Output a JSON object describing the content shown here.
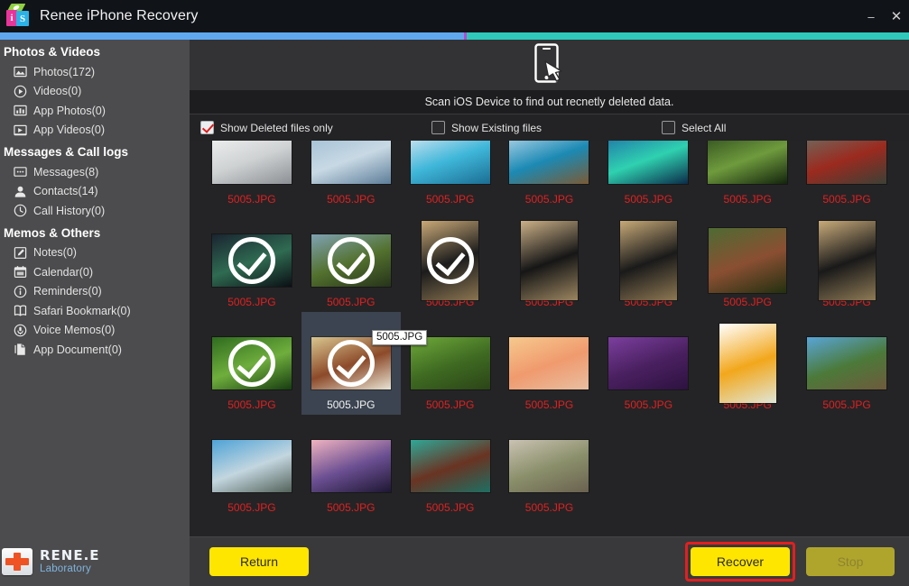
{
  "window": {
    "title": "Renee iPhone Recovery",
    "logo_letters": [
      "i",
      "S"
    ],
    "controls": [
      {
        "name": "minimize",
        "glyph": "–"
      },
      {
        "name": "close",
        "glyph": "✕"
      }
    ]
  },
  "progress": {
    "blue_percent": 51,
    "blue_color": "#5fa8ef",
    "marker_color": "#b34ad6",
    "teal_color": "#2ec9bb"
  },
  "sidebar": {
    "groups": [
      {
        "label": "Photos & Videos",
        "items": [
          {
            "icon": "image-icon",
            "label": "Photos(172)"
          },
          {
            "icon": "play-circle-icon",
            "label": "Videos(0)"
          },
          {
            "icon": "bar-chart-icon",
            "label": "App Photos(0)"
          },
          {
            "icon": "video-frame-icon",
            "label": "App Videos(0)"
          }
        ]
      },
      {
        "label": "Messages & Call logs",
        "items": [
          {
            "icon": "message-icon",
            "label": "Messages(8)"
          },
          {
            "icon": "contact-icon",
            "label": "Contacts(14)"
          },
          {
            "icon": "clock-icon",
            "label": "Call History(0)"
          }
        ]
      },
      {
        "label": "Memos & Others",
        "items": [
          {
            "icon": "note-pencil-icon",
            "label": "Notes(0)"
          },
          {
            "icon": "calendar-icon",
            "label": "Calendar(0)"
          },
          {
            "icon": "info-circle-icon",
            "label": "Reminders(0)"
          },
          {
            "icon": "book-icon",
            "label": "Safari Bookmark(0)"
          },
          {
            "icon": "microphone-icon",
            "label": "Voice Memos(0)"
          },
          {
            "icon": "document-icon",
            "label": "App Document(0)"
          }
        ]
      }
    ]
  },
  "brand": {
    "name": "RENE.E",
    "sub": "Laboratory",
    "icon": "first-aid-kit-icon"
  },
  "main": {
    "hero_icon": "phone-tap-icon",
    "scan_message": "Scan iOS Device to find out recnetly deleted data.",
    "filters": [
      {
        "name": "show-deleted-only",
        "label": "Show Deleted files only",
        "checked": true
      },
      {
        "name": "show-existing",
        "label": "Show Existing files",
        "checked": false
      },
      {
        "name": "select-all",
        "label": "Select All",
        "checked": false
      }
    ],
    "tooltip": {
      "text": "5005.JPG",
      "visible": true
    }
  },
  "grid": {
    "filename_color": "#e12020",
    "selected_filename_color": "#f2f2f2",
    "columns": 7,
    "items": [
      {
        "name": "kitchen-counter",
        "label": "5005.JPG",
        "selected": false,
        "shape": "landscape",
        "c1": "#f2f3f3",
        "c2": "#cfd2d3",
        "c3": "#8c9094"
      },
      {
        "name": "lake-reflection",
        "label": "5005.JPG",
        "selected": false,
        "shape": "landscape",
        "c1": "#9fbdd4",
        "c2": "#c8d9e4",
        "c3": "#5d7d99"
      },
      {
        "name": "mountain-lake",
        "label": "5005.JPG",
        "selected": false,
        "shape": "landscape",
        "c1": "#dbe9f4",
        "c2": "#3fb7d9",
        "c3": "#1b6d93"
      },
      {
        "name": "pier-sunset",
        "label": "5005.JPG",
        "selected": false,
        "shape": "landscape",
        "c1": "#b9d9ec",
        "c2": "#1c8ab4",
        "c3": "#7b5a35"
      },
      {
        "name": "aurora-water",
        "label": "5005.JPG",
        "selected": false,
        "shape": "landscape",
        "c1": "#1e6fa8",
        "c2": "#2fd1b0",
        "c3": "#0b2b4a"
      },
      {
        "name": "green-forest",
        "label": "5005.JPG",
        "selected": false,
        "shape": "landscape",
        "c1": "#2d4a1c",
        "c2": "#6f9b3d",
        "c3": "#13240c"
      },
      {
        "name": "red-door-alley",
        "label": "5005.JPG",
        "selected": false,
        "shape": "landscape",
        "c1": "#6a6f63",
        "c2": "#9b2a1f",
        "c3": "#3c4036"
      },
      {
        "name": "street-night",
        "label": "5005.JPG",
        "selected": false,
        "shape": "landscape",
        "checked": true,
        "c1": "#1a2430",
        "c2": "#2f6b52",
        "c3": "#0b0f14"
      },
      {
        "name": "hillside-village",
        "label": "5005.JPG",
        "selected": false,
        "shape": "landscape",
        "checked": true,
        "c1": "#7fa2b3",
        "c2": "#53712e",
        "c3": "#26331a"
      },
      {
        "name": "keyboard-desk-1",
        "label": "5005.JPG",
        "selected": false,
        "shape": "portrait",
        "checked": true,
        "c1": "#c9a977",
        "c2": "#1c1c1c",
        "c3": "#8a7450"
      },
      {
        "name": "keyboard-desk-2",
        "label": "5005.JPG",
        "selected": false,
        "shape": "portrait",
        "c1": "#cbb087",
        "c2": "#161616",
        "c3": "#9b8560"
      },
      {
        "name": "keyboard-desk-3",
        "label": "5005.JPG",
        "selected": false,
        "shape": "portrait",
        "c1": "#c7a977",
        "c2": "#1a1a1a",
        "c3": "#8d7752"
      },
      {
        "name": "old-shop-front",
        "label": "5005.JPG",
        "selected": false,
        "shape": "square",
        "c1": "#4e6b33",
        "c2": "#8a4f33",
        "c3": "#22300f"
      },
      {
        "name": "keyboard-desk-4",
        "label": "5005.JPG",
        "selected": false,
        "shape": "portrait",
        "c1": "#c9ab7a",
        "c2": "#191919",
        "c3": "#8e7a55"
      },
      {
        "name": "river-jungle",
        "label": "5005.JPG",
        "selected": false,
        "shape": "landscape",
        "checked": true,
        "c1": "#2f6b1f",
        "c2": "#6fae3d",
        "c3": "#173d10"
      },
      {
        "name": "food-plate",
        "label": "5005.JPG",
        "selected": true,
        "shape": "landscape",
        "checked": true,
        "c1": "#d9c68f",
        "c2": "#8c4a2a",
        "c3": "#e8e3d2"
      },
      {
        "name": "game-village-map",
        "label": "5005.JPG",
        "selected": false,
        "shape": "landscape",
        "c1": "#6fa83a",
        "c2": "#3f6b22",
        "c3": "#2b4417"
      },
      {
        "name": "orange-sea-sunset",
        "label": "5005.JPG",
        "selected": false,
        "shape": "landscape",
        "c1": "#f6c98e",
        "c2": "#f09a6e",
        "c3": "#e8bfa1"
      },
      {
        "name": "lavender-field",
        "label": "5005.JPG",
        "selected": false,
        "shape": "landscape",
        "c1": "#7b3f9e",
        "c2": "#4a2060",
        "c3": "#2d1240"
      },
      {
        "name": "browser-map-page",
        "label": "5005.JPG",
        "selected": false,
        "shape": "portrait",
        "c1": "#ffffff",
        "c2": "#f2a71b",
        "c3": "#dfe6d8"
      },
      {
        "name": "mountain-ruins",
        "label": "5005.JPG",
        "selected": false,
        "shape": "landscape",
        "c1": "#59a5d8",
        "c2": "#4b7a3a",
        "c3": "#6e5a3c"
      },
      {
        "name": "calm-lake-clouds",
        "label": "5005.JPG",
        "selected": false,
        "shape": "landscape",
        "c1": "#4ea3d6",
        "c2": "#c3d6df",
        "c3": "#53625a"
      },
      {
        "name": "purple-dusk-hills",
        "label": "5005.JPG",
        "selected": false,
        "shape": "landscape",
        "c1": "#f0b3c0",
        "c2": "#6b4f92",
        "c3": "#1e1733"
      },
      {
        "name": "teal-house-door",
        "label": "5005.JPG",
        "selected": false,
        "shape": "landscape",
        "c1": "#2fa898",
        "c2": "#6a3322",
        "c3": "#1d6f63"
      },
      {
        "name": "garden-wall-decor",
        "label": "5005.JPG",
        "selected": false,
        "shape": "landscape",
        "c1": "#c9c2b2",
        "c2": "#8a8f6a",
        "c3": "#6a6150"
      }
    ]
  },
  "actions": {
    "return_label": "Return",
    "recover_label": "Recover",
    "stop_label": "Stop",
    "stop_disabled": true,
    "recover_highlight_color": "#e02020"
  }
}
